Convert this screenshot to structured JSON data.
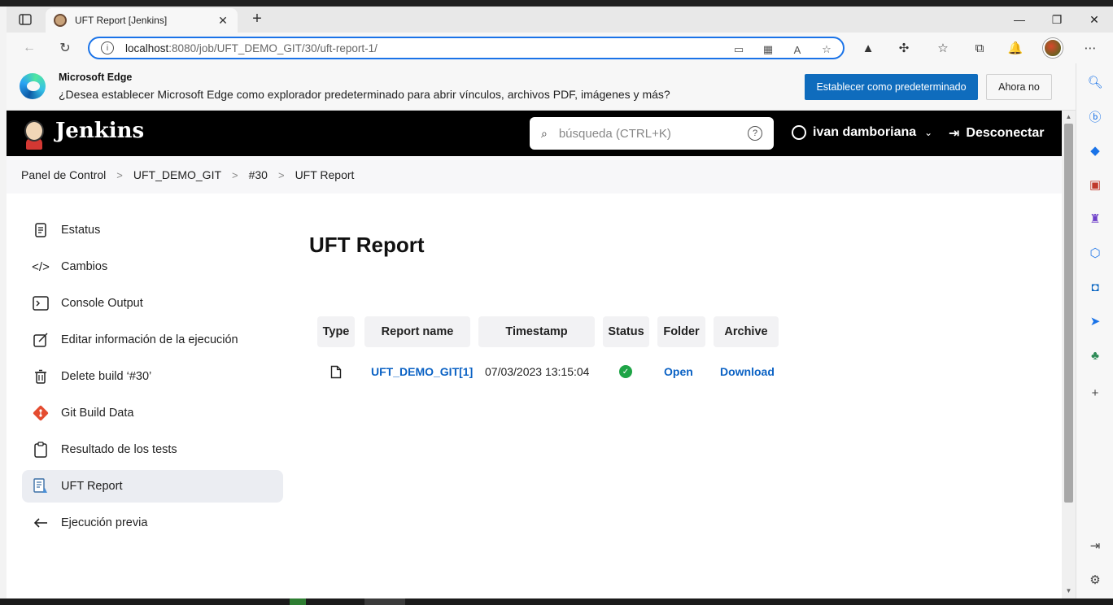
{
  "browser": {
    "tab_title": "UFT Report [Jenkins]",
    "url_host": "localhost",
    "url_rest": ":8080/job/UFT_DEMO_GIT/30/uft-report-1/"
  },
  "banner": {
    "title": "Microsoft Edge",
    "text": "¿Desea establecer Microsoft Edge como explorador predeterminado para abrir vínculos, archivos PDF, imágenes y más?",
    "primary_btn": "Establecer como predeterminado",
    "secondary_btn": "Ahora no"
  },
  "jenkins": {
    "title": "Jenkins",
    "search_placeholder": "búsqueda (CTRL+K)",
    "user": "ivan damboriana",
    "logout": "Desconectar"
  },
  "breadcrumb": [
    "Panel de Control",
    "UFT_DEMO_GIT",
    "#30",
    "UFT Report"
  ],
  "sidebar": [
    {
      "label": "Estatus",
      "icon": "document-icon"
    },
    {
      "label": "Cambios",
      "icon": "code-icon"
    },
    {
      "label": "Console Output",
      "icon": "terminal-icon"
    },
    {
      "label": "Editar información de la ejecución",
      "icon": "edit-icon"
    },
    {
      "label": "Delete build ‘#30’",
      "icon": "trash-icon"
    },
    {
      "label": "Git Build Data",
      "icon": "git-icon"
    },
    {
      "label": "Resultado de los tests",
      "icon": "clipboard-icon"
    },
    {
      "label": "UFT Report",
      "icon": "report-icon"
    },
    {
      "label": "Ejecución previa",
      "icon": "arrow-left-icon"
    }
  ],
  "main": {
    "heading": "UFT Report",
    "table": {
      "headers": [
        "Type",
        "Report name",
        "Timestamp",
        "Status",
        "Folder",
        "Archive"
      ],
      "rows": [
        {
          "type_icon": "file-icon",
          "report_name": "UFT_DEMO_GIT[1]",
          "timestamp": "07/03/2023 13:15:04",
          "status": "success",
          "folder": "Open",
          "archive": "Download"
        }
      ]
    }
  },
  "colors": {
    "accent": "#0b62c4",
    "edge_primary": "#0f6cbd",
    "success": "#1ea446",
    "jenkins_header": "#000000"
  }
}
